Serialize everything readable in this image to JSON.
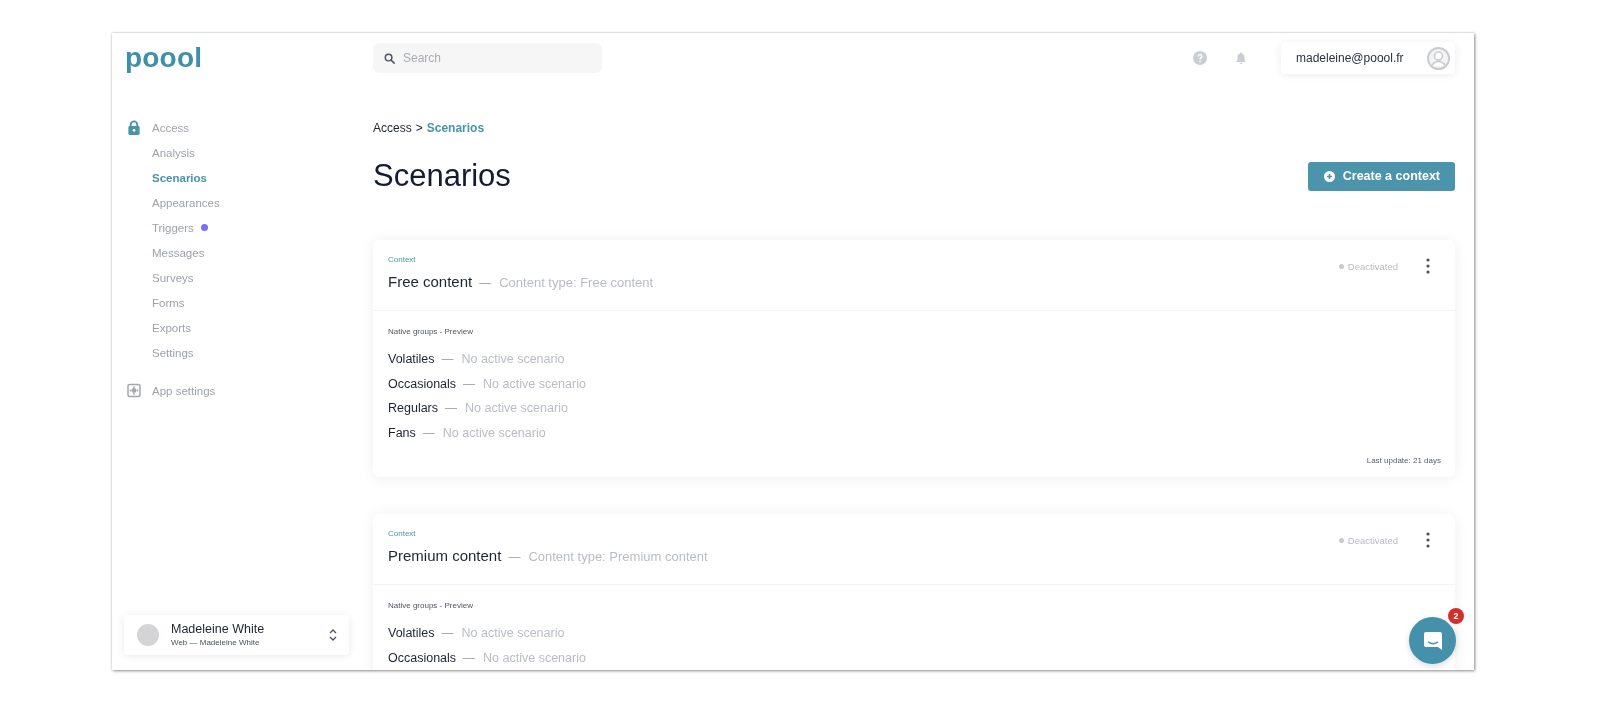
{
  "logo": {
    "text": "poool"
  },
  "search": {
    "placeholder": "Search"
  },
  "user": {
    "email": "madeleine@poool.fr"
  },
  "sidebar": {
    "items": [
      {
        "label": "Access",
        "selected": false,
        "children": [
          {
            "label": "Analysis",
            "selected": false,
            "notification": false
          },
          {
            "label": "Scenarios",
            "selected": true,
            "notification": false
          },
          {
            "label": "Appearances",
            "selected": false,
            "notification": false
          },
          {
            "label": "Triggers",
            "selected": false,
            "notification": true
          },
          {
            "label": "Messages",
            "selected": false,
            "notification": false
          },
          {
            "label": "Surveys",
            "selected": false,
            "notification": false
          },
          {
            "label": "Forms",
            "selected": false,
            "notification": false
          },
          {
            "label": "Exports",
            "selected": false,
            "notification": false
          },
          {
            "label": "Settings",
            "selected": false,
            "notification": false
          }
        ]
      },
      {
        "label": "App settings",
        "selected": false
      }
    ]
  },
  "account": {
    "name": "Madeleine White",
    "subtitle": "Web — Madeleine White"
  },
  "breadcrumb": {
    "items": [
      {
        "label": "Access",
        "current": false
      },
      {
        "label": "Scenarios",
        "current": true
      }
    ],
    "separator": ">"
  },
  "page_title": "Scenarios",
  "create_button": {
    "label": "Create a context"
  },
  "contexts": [
    {
      "label": "Context",
      "name": "Free content",
      "separator": "—",
      "content_type": "Content type: Free content",
      "active": false,
      "status": "Deactivated",
      "groups_title": "Native groups - Preview",
      "groups": [
        {
          "name": "Volatiles",
          "separator": "—",
          "status": "No active scenario"
        },
        {
          "name": "Occasionals",
          "separator": "—",
          "status": "No active scenario"
        },
        {
          "name": "Regulars",
          "separator": "—",
          "status": "No active scenario"
        },
        {
          "name": "Fans",
          "separator": "—",
          "status": "No active scenario"
        }
      ],
      "last_update": "Last update: 21 days"
    },
    {
      "label": "Context",
      "name": "Premium content",
      "separator": "—",
      "content_type": "Content type: Premium content",
      "active": false,
      "status": "Deactivated",
      "groups_title": "Native groups - Preview",
      "groups": [
        {
          "name": "Volatiles",
          "separator": "—",
          "status": "No active scenario"
        },
        {
          "name": "Occasionals",
          "separator": "—",
          "status": "No active scenario"
        }
      ]
    }
  ],
  "chat": {
    "unread": "2"
  }
}
